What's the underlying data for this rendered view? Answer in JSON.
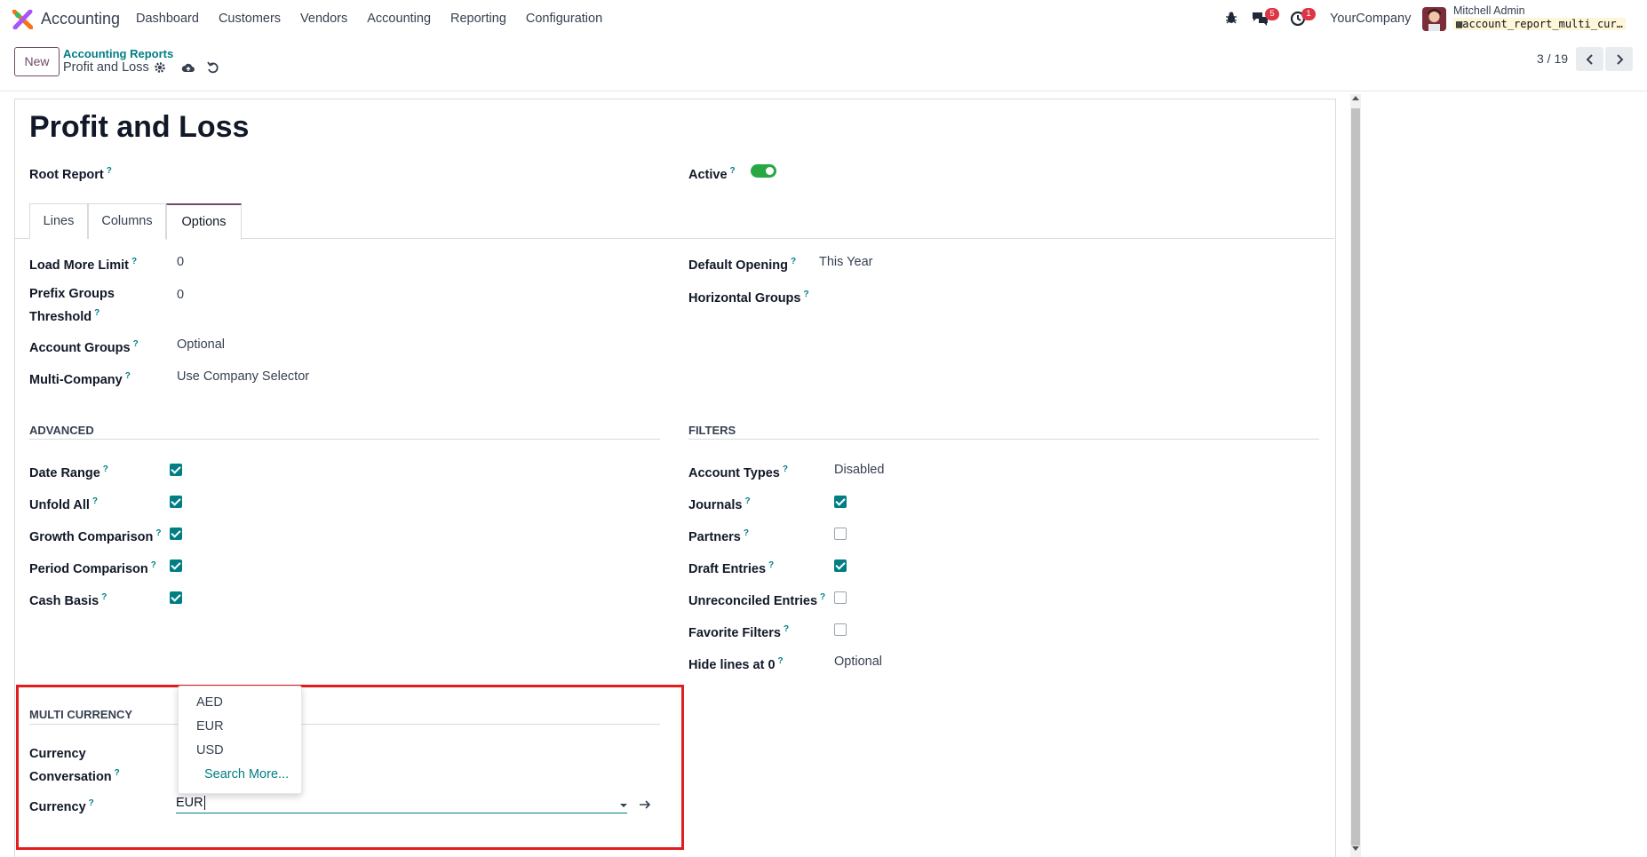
{
  "navbar": {
    "app_name": "Accounting",
    "menu": [
      "Dashboard",
      "Customers",
      "Vendors",
      "Accounting",
      "Reporting",
      "Configuration"
    ],
    "chat_badge": "5",
    "activity_badge": "1",
    "company": "YourCompany",
    "user_name": "Mitchell Admin",
    "database": "account_report_multi_cur…"
  },
  "control_panel": {
    "new_label": "New",
    "breadcrumb_parent": "Accounting Reports",
    "breadcrumb_current": "Profit and Loss",
    "pager": "3 / 19"
  },
  "form": {
    "title": "Profit and Loss",
    "root_report_label": "Root Report",
    "active_label": "Active",
    "active": true,
    "tabs": [
      "Lines",
      "Columns",
      "Options"
    ],
    "active_tab": "Options",
    "options_left": [
      {
        "label": "Load More Limit",
        "value": "0"
      },
      {
        "label": "Prefix Groups Threshold",
        "value": "0"
      },
      {
        "label": "Account Groups",
        "value": "Optional"
      },
      {
        "label": "Multi-Company",
        "value": "Use Company Selector"
      }
    ],
    "options_right": [
      {
        "label": "Default Opening",
        "value": "This Year"
      },
      {
        "label": "Horizontal Groups",
        "value": ""
      }
    ],
    "advanced": {
      "title": "ADVANCED",
      "fields": [
        {
          "label": "Date Range",
          "checked": true
        },
        {
          "label": "Unfold All",
          "checked": true
        },
        {
          "label": "Growth Comparison",
          "checked": true
        },
        {
          "label": "Period Comparison",
          "checked": true
        },
        {
          "label": "Cash Basis",
          "checked": true
        }
      ]
    },
    "filters": {
      "title": "FILTERS",
      "account_types_label": "Account Types",
      "account_types_value": "Disabled",
      "fields": [
        {
          "label": "Journals",
          "checked": true
        },
        {
          "label": "Partners",
          "checked": false
        },
        {
          "label": "Draft Entries",
          "checked": true
        },
        {
          "label": "Unreconciled Entries",
          "checked": false
        },
        {
          "label": "Favorite Filters",
          "checked": false
        }
      ],
      "hide_lines_label": "Hide lines at 0",
      "hide_lines_value": "Optional"
    },
    "multi_currency": {
      "title": "MULTI CURRENCY",
      "conversion_label_1": "Currency",
      "conversion_label_2": "Conversation",
      "currency_label": "Currency",
      "currency_value": "EUR",
      "dropdown_options": [
        "AED",
        "EUR",
        "USD"
      ],
      "search_more": "Search More..."
    }
  },
  "colors": {
    "brand": "#714b67",
    "accent": "#017e84",
    "toggle_on": "#28a745",
    "highlight_border": "#e11d1d",
    "badge": "#dc3545"
  }
}
